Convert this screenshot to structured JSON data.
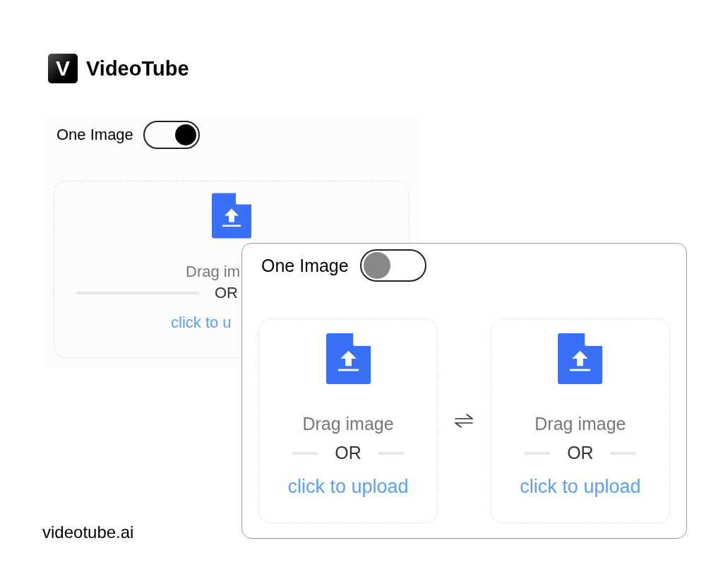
{
  "brand": {
    "mark": "V",
    "name": "VideoTube"
  },
  "panels": [
    {
      "toggle": {
        "label": "One Image",
        "on": true
      },
      "dropzones": [
        {
          "drag_text": "Drag im",
          "or_text": "OR",
          "link": "click to u"
        }
      ]
    },
    {
      "toggle": {
        "label": "One Image",
        "on": false
      },
      "dropzones": [
        {
          "drag_text": "Drag image",
          "or_text": "OR",
          "link": "click to upload"
        },
        {
          "drag_text": "Drag image",
          "or_text": "OR",
          "link": "click to upload"
        }
      ]
    }
  ],
  "footer": "videotube.ai"
}
